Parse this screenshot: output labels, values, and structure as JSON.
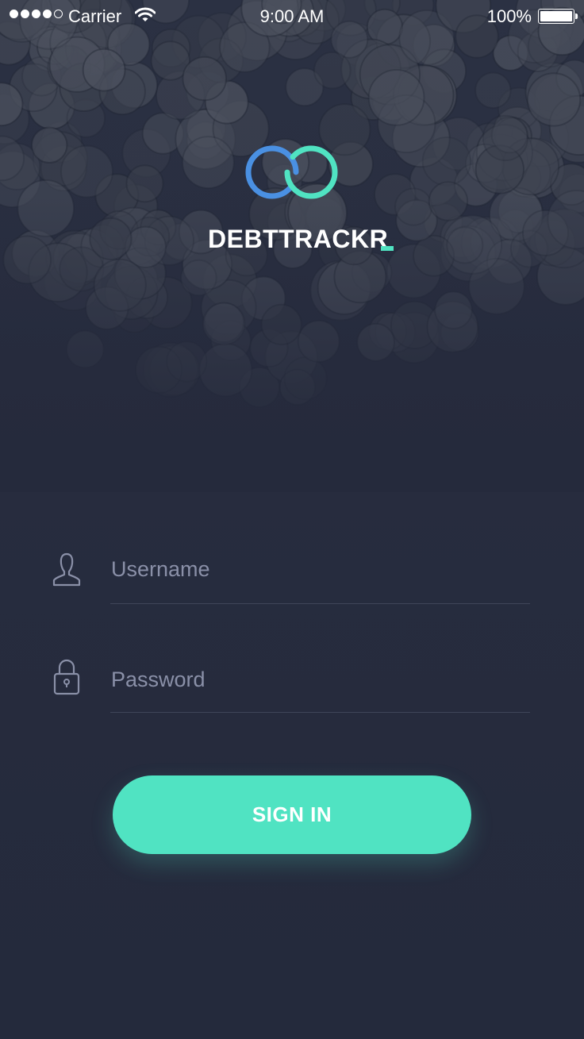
{
  "status_bar": {
    "carrier": "Carrier",
    "time": "9:00 AM",
    "battery_percent": "100%",
    "signal_bars": 4,
    "signal_bars_total": 5
  },
  "app": {
    "name": "DEBTTRACKR",
    "logo_icon": "interlocked-rings-logo",
    "accent_color": "#50e3c2",
    "logo_blue": "#4a90e2"
  },
  "login_form": {
    "username": {
      "icon": "user-icon",
      "placeholder": "Username",
      "value": ""
    },
    "password": {
      "icon": "lock-icon",
      "placeholder": "Password",
      "value": ""
    },
    "submit_label": "SIGN IN"
  },
  "colors": {
    "background": "#252a3c",
    "field_underline": "#3f4559",
    "placeholder": "#8a90a8"
  }
}
